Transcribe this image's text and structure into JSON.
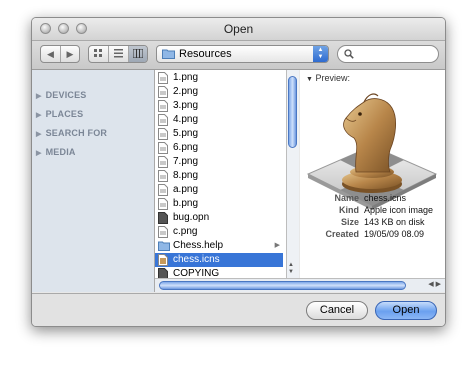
{
  "window": {
    "title": "Open"
  },
  "toolbar": {
    "back_glyph": "◀",
    "forward_glyph": "▶",
    "view_icons": [
      "icon-view-icon",
      "list-view-icon",
      "column-view-icon"
    ],
    "location": "Resources",
    "search_placeholder": ""
  },
  "sidebar": {
    "sections": [
      "DEVICES",
      "PLACES",
      "SEARCH FOR",
      "MEDIA"
    ]
  },
  "files": [
    {
      "name": "1.png",
      "icon": "image-file-icon"
    },
    {
      "name": "2.png",
      "icon": "image-file-icon"
    },
    {
      "name": "3.png",
      "icon": "image-file-icon"
    },
    {
      "name": "4.png",
      "icon": "image-file-icon"
    },
    {
      "name": "5.png",
      "icon": "image-file-icon"
    },
    {
      "name": "6.png",
      "icon": "image-file-icon"
    },
    {
      "name": "7.png",
      "icon": "image-file-icon"
    },
    {
      "name": "8.png",
      "icon": "image-file-icon"
    },
    {
      "name": "a.png",
      "icon": "image-file-icon"
    },
    {
      "name": "b.png",
      "icon": "image-file-icon"
    },
    {
      "name": "bug.opn",
      "icon": "document-file-icon"
    },
    {
      "name": "c.png",
      "icon": "image-file-icon"
    },
    {
      "name": "Chess.help",
      "icon": "folder-icon"
    },
    {
      "name": "chess.icns",
      "icon": "icns-file-icon"
    },
    {
      "name": "COPYING",
      "icon": "document-file-icon"
    }
  ],
  "preview": {
    "header": "Preview:",
    "image": "chess-knight-icon",
    "labels": {
      "name": "Name",
      "kind": "Kind",
      "size": "Size",
      "created": "Created"
    },
    "values": {
      "name": "chess.icns",
      "kind": "Apple icon image",
      "size": "143 KB on disk",
      "created": "19/05/09 08.09"
    }
  },
  "buttons": {
    "cancel": "Cancel",
    "open": "Open"
  },
  "colors": {
    "selection": "#3875d7",
    "sidebar": "#dde4ec",
    "default_button": "#6aa0ef"
  }
}
